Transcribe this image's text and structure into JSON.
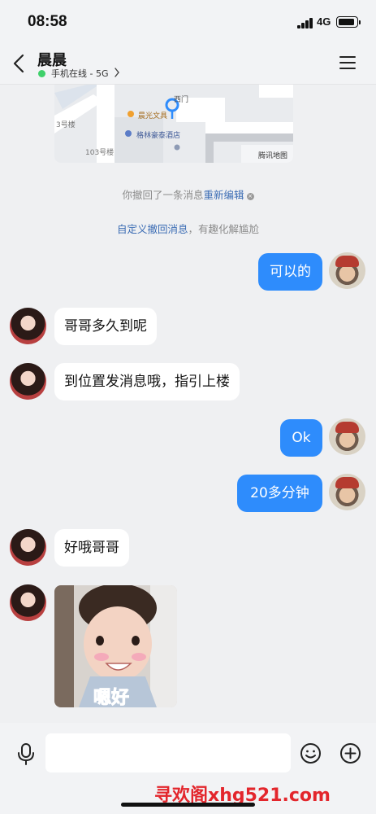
{
  "status_bar": {
    "time": "08:58",
    "network": "4G"
  },
  "header": {
    "contact_name": "晨晨",
    "online_status": "手机在线 - 5G",
    "back_icon": "back-chevron-icon",
    "menu_icon": "hamburger-menu-icon"
  },
  "map": {
    "labels": [
      "西门",
      "晨光文具",
      "格林豪泰酒店",
      "3号楼",
      "103号楼",
      "腾讯地图"
    ]
  },
  "notices": {
    "recall_text": "你撤回了一条消息",
    "recall_link": "重新编辑",
    "custom_link": "自定义撤回消息",
    "custom_suffix": "，有趣化解尴尬"
  },
  "messages": [
    {
      "side": "out",
      "text": "可以的"
    },
    {
      "side": "in",
      "text": "哥哥多久到呢"
    },
    {
      "side": "in",
      "text": "到位置发消息哦，指引上楼"
    },
    {
      "side": "out",
      "text": "Ok"
    },
    {
      "side": "out",
      "text": "20多分钟"
    },
    {
      "side": "in",
      "text": "好哦哥哥"
    },
    {
      "side": "in",
      "type": "sticker",
      "text": "嗯好"
    }
  ],
  "input_bar": {
    "placeholder": "",
    "icons": [
      "microphone-icon",
      "emoji-icon",
      "plus-icon"
    ]
  },
  "watermark": "寻欢阁xhg521.com",
  "colors": {
    "accent_blue": "#2e8cfc",
    "online_green": "#3fd06a",
    "link_blue": "#3b6cb4",
    "watermark_red": "#e3262c"
  }
}
